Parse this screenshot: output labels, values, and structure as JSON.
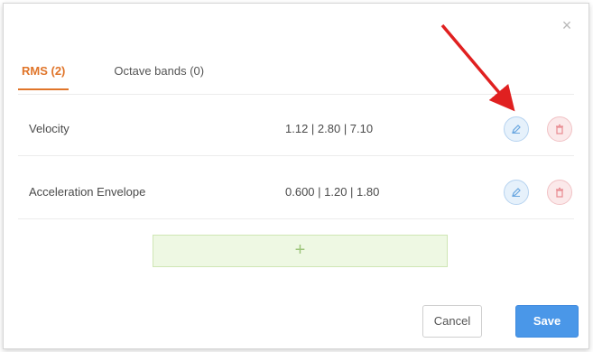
{
  "dialog": {
    "close_symbol": "×",
    "tabs": [
      {
        "label": "RMS (2)",
        "active": true
      },
      {
        "label": "Octave bands (0)",
        "active": false
      }
    ],
    "rows": [
      {
        "name": "Velocity",
        "values": "1.12 | 2.80 | 7.10",
        "edit_icon": "pencil-icon",
        "delete_icon": "trash-icon"
      },
      {
        "name": "Acceleration Envelope",
        "values": "0.600 | 1.20 | 1.80",
        "edit_icon": "pencil-icon",
        "delete_icon": "trash-icon"
      }
    ],
    "add_symbol": "+",
    "cancel_label": "Cancel",
    "save_label": "Save"
  },
  "colors": {
    "accent_orange": "#e0752a",
    "save_blue": "#4a97e8",
    "edit_blue": "#6aa7e0",
    "delete_red": "#e88a90",
    "add_green_bg": "#eef8e3",
    "annotation_arrow": "#e02020"
  },
  "annotation": {
    "type": "arrow",
    "target": "edit-button-row-1"
  }
}
